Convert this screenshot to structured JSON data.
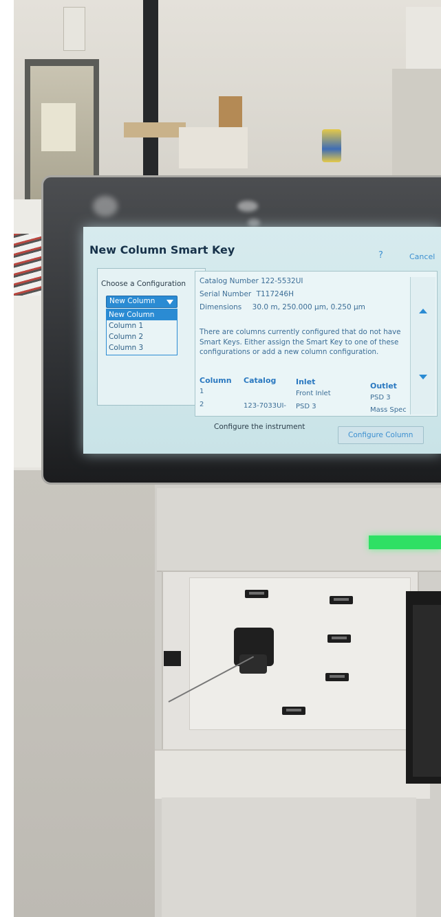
{
  "dialog": {
    "title": "New Column Smart Key",
    "help_label": "?",
    "cancel_label": "Cancel"
  },
  "configuration": {
    "label": "Choose a Configuration",
    "selected": "New Column",
    "options": [
      "New Column",
      "Column 1",
      "Column 2",
      "Column 3"
    ]
  },
  "details": {
    "catalog_label": "Catalog Number",
    "catalog_value": "122-5532UI",
    "serial_label": "Serial Number",
    "serial_value": "T117246H",
    "dimensions_label": "Dimensions",
    "dimensions_value": "30.0 m, 250.000 µm, 0.250 µm",
    "message": "There are columns currently configured that do not have Smart Keys. Either assign the Smart Key to one of these configurations or add a new column configuration."
  },
  "table": {
    "headers": [
      "Column",
      "Catalog",
      "Inlet",
      "Outlet"
    ],
    "rows": [
      [
        "1",
        "",
        "Front Inlet",
        "PSD 3"
      ],
      [
        "2",
        "123-7033UI-",
        "PSD 3",
        "Mass Spec"
      ]
    ]
  },
  "footer": {
    "text": "Configure the instrument",
    "button_label": "Configure Column"
  },
  "colors": {
    "accent": "#2a8bd3",
    "screen_bg": "#d7ebee",
    "status_led": "#2fe064"
  }
}
